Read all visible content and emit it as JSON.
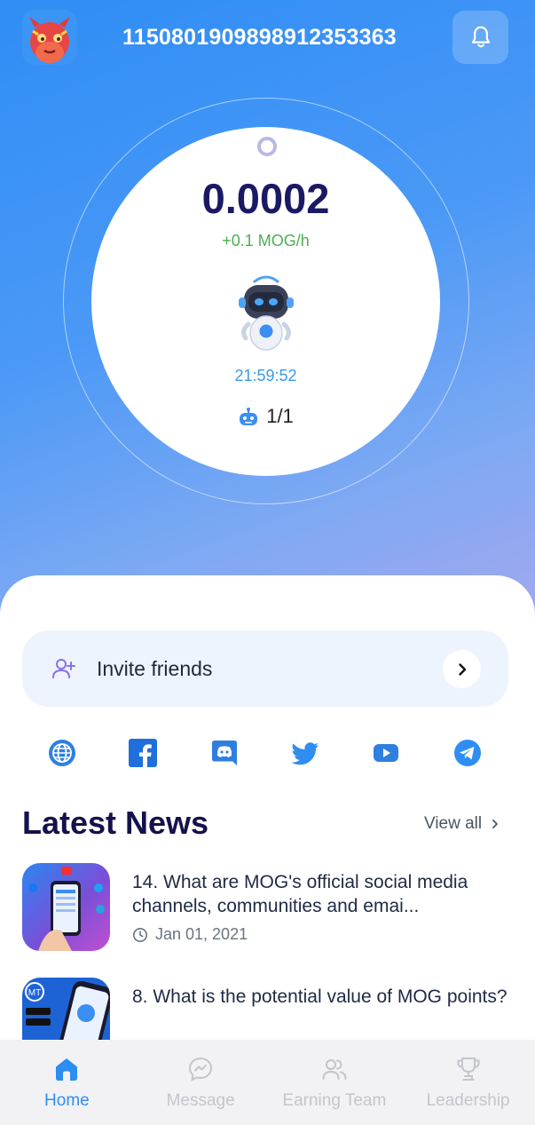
{
  "header": {
    "user_id": "1150801909898912353363",
    "avatar_icon": "red-dragon-avatar",
    "bell_icon": "bell-icon"
  },
  "mining": {
    "balance": "0.0002",
    "rate": "+0.1 MOG/h",
    "timer": "21:59:52",
    "bots": "1/1"
  },
  "invite": {
    "label": "Invite friends"
  },
  "socials": [
    "globe-icon",
    "facebook-icon",
    "discord-icon",
    "twitter-icon",
    "youtube-icon",
    "telegram-icon"
  ],
  "news": {
    "title": "Latest News",
    "view_all": "View all",
    "items": [
      {
        "title": "14. What are MOG's official social media channels, communities and emai...",
        "date": "Jan 01, 2021"
      },
      {
        "title": "8. What is the potential value of MOG points?",
        "date": ""
      }
    ]
  },
  "tabs": [
    {
      "label": "Home",
      "icon": "home-icon",
      "active": true
    },
    {
      "label": "Message",
      "icon": "message-icon",
      "active": false
    },
    {
      "label": "Earning Team",
      "icon": "team-icon",
      "active": false
    },
    {
      "label": "Leadership",
      "icon": "trophy-icon",
      "active": false
    }
  ],
  "colors": {
    "primary": "#2d8ef2",
    "balance_text": "#1b1964",
    "rate_text": "#4caf50",
    "timer_text": "#3a9ae8"
  }
}
